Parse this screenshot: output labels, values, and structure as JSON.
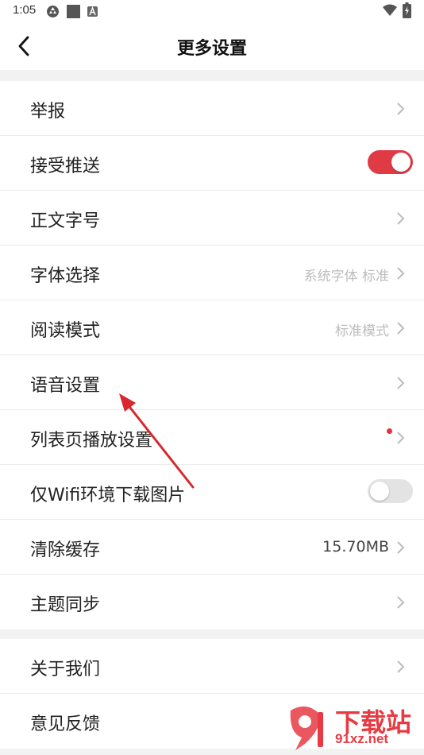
{
  "status_bar": {
    "time": "1:05",
    "icons": [
      "recycle-icon",
      "square-icon",
      "a-icon",
      "wifi-icon",
      "battery-icon"
    ]
  },
  "header": {
    "title": "更多设置",
    "back_icon": "chevron-left-icon"
  },
  "settings": {
    "report": {
      "label": "举报"
    },
    "push": {
      "label": "接受推送",
      "enabled": true
    },
    "font_size": {
      "label": "正文字号"
    },
    "font_select": {
      "label": "字体选择",
      "value": "系统字体 标准"
    },
    "reading_mode": {
      "label": "阅读模式",
      "value": "标准模式"
    },
    "voice": {
      "label": "语音设置"
    },
    "list_playback": {
      "label": "列表页播放设置",
      "has_dot": true
    },
    "wifi_images": {
      "label": "仅Wifi环境下载图片",
      "enabled": false
    },
    "clear_cache": {
      "label": "清除缓存",
      "value": "15.70MB"
    },
    "theme_sync": {
      "label": "主题同步"
    },
    "about": {
      "label": "关于我们"
    },
    "feedback": {
      "label": "意见反馈"
    }
  },
  "watermark": {
    "line1": "下载站",
    "line2": "91xz.net"
  },
  "colors": {
    "accent": "#e03a45",
    "divider": "#ececec",
    "section_gap": "#f2f2f2",
    "secondary_text": "#bdbdbd"
  }
}
